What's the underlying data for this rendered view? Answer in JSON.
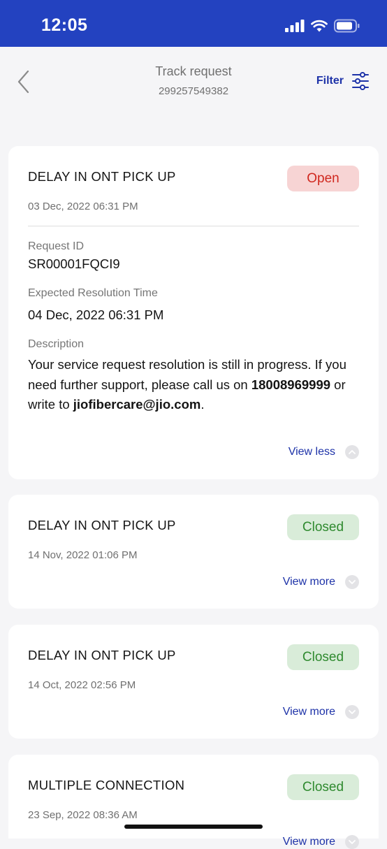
{
  "status": {
    "time": "12:05"
  },
  "header": {
    "title": "Track request",
    "subtitle": "299257549382",
    "filter_label": "Filter"
  },
  "requests": [
    {
      "title": "DELAY IN ONT PICK UP",
      "status": "Open",
      "date": "03 Dec, 2022 06:31 PM",
      "request_id_label": "Request ID",
      "request_id": "SR00001FQCI9",
      "resolution_label": "Expected Resolution Time",
      "resolution_time": "04 Dec, 2022 06:31 PM",
      "description_label": "Description",
      "description_part1": "Your service request resolution is still in progress. If you need further support, please call us on ",
      "description_phone": "18008969999",
      "description_part2": " or write to ",
      "description_email": "jiofibercare@jio.com",
      "description_end": ".",
      "toggle_label": "View less"
    },
    {
      "title": "DELAY IN ONT PICK UP",
      "status": "Closed",
      "date": "14 Nov, 2022 01:06 PM",
      "toggle_label": "View more"
    },
    {
      "title": "DELAY IN ONT PICK UP",
      "status": "Closed",
      "date": "14 Oct, 2022 02:56 PM",
      "toggle_label": "View more"
    },
    {
      "title": "MULTIPLE CONNECTION",
      "status": "Closed",
      "date": "23 Sep, 2022 08:36 AM",
      "toggle_label": "View more"
    }
  ],
  "colors": {
    "status_bar": "#2342c0",
    "accent": "#1d32a8",
    "open_badge_bg": "#f7d4d4",
    "open_badge_text": "#d0281f",
    "closed_badge_bg": "#d9ecd9",
    "closed_badge_text": "#2f8a2f"
  },
  "icons": {
    "back": "chevron-left-icon",
    "filter": "sliders-icon",
    "expand": "chevron-down-icon",
    "collapse": "chevron-up-icon"
  }
}
